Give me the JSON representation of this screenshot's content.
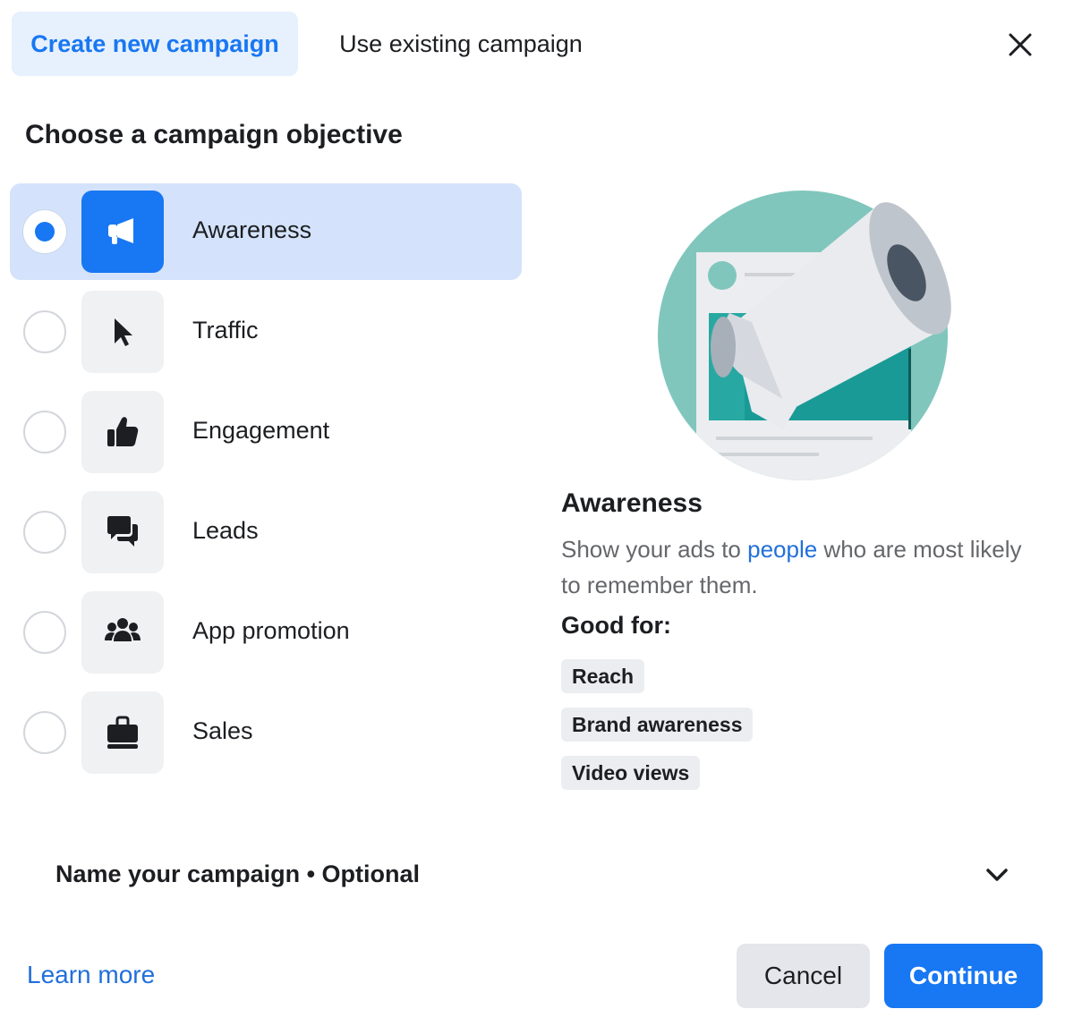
{
  "tabs": {
    "create_label": "Create new campaign",
    "existing_label": "Use existing campaign"
  },
  "heading": "Choose a campaign objective",
  "objectives": [
    {
      "label": "Awareness",
      "icon": "megaphone-icon",
      "selected": true
    },
    {
      "label": "Traffic",
      "icon": "cursor-icon",
      "selected": false
    },
    {
      "label": "Engagement",
      "icon": "thumbs-up-icon",
      "selected": false
    },
    {
      "label": "Leads",
      "icon": "chat-bubbles-icon",
      "selected": false
    },
    {
      "label": "App promotion",
      "icon": "people-group-icon",
      "selected": false
    },
    {
      "label": "Sales",
      "icon": "shopping-bag-icon",
      "selected": false
    }
  ],
  "detail": {
    "title": "Awareness",
    "desc_before": "Show your ads to ",
    "desc_link": "people",
    "desc_after": " who are most likely to remember them.",
    "good_for_label": "Good for:",
    "chips": [
      "Reach",
      "Brand awareness",
      "Video views"
    ]
  },
  "name_section": {
    "label": "Name your campaign • Optional"
  },
  "footer": {
    "learn_more": "Learn more",
    "cancel": "Cancel",
    "continue": "Continue"
  },
  "colors": {
    "accent": "#1877f2",
    "selected_bg": "#d4e3fb",
    "tab_active_bg": "#e7f0fd",
    "illustration_teal": "#80c6bd",
    "illustration_dark_teal": "#1a9a96"
  }
}
